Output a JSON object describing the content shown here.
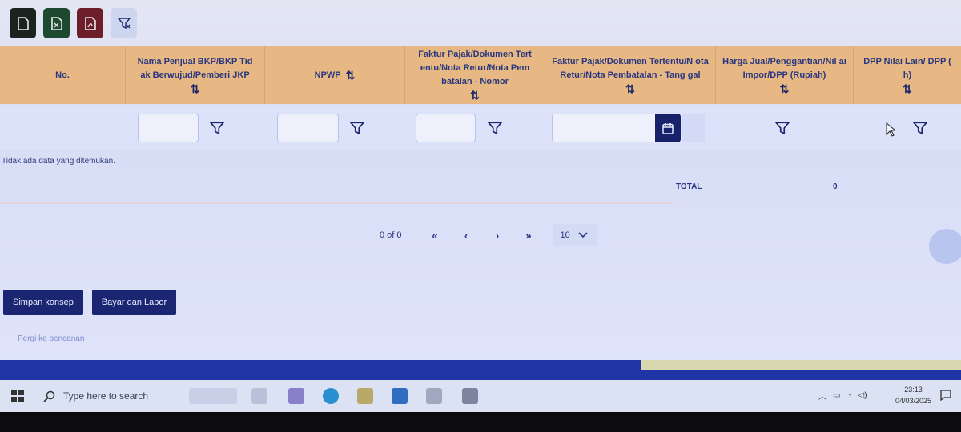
{
  "toolbar": {
    "buttons": [
      "new-doc-icon",
      "excel-icon",
      "pdf-icon",
      "clear-filter-icon"
    ]
  },
  "table": {
    "columns": [
      {
        "label": "No.",
        "sortable": false
      },
      {
        "label": "Nama Penjual BKP/BKP Tid ak Berwujud/Pemberi JKP",
        "sortable": true
      },
      {
        "label": "NPWP",
        "sortable": true
      },
      {
        "label": "Faktur Pajak/Dokumen Tert entu/Nota Retur/Nota Pem batalan - Nomor",
        "sortable": true
      },
      {
        "label": "Faktur Pajak/Dokumen Tertentu/N ota Retur/Nota Pembatalan - Tang gal",
        "sortable": true
      },
      {
        "label": "Harga Jual/Penggantian/Nil ai Impor/DPP (Rupiah)",
        "sortable": true
      },
      {
        "label": "DPP Nilai Lain/ DPP ( h)",
        "sortable": true
      }
    ],
    "sort_glyph": "⇅",
    "empty_message": "Tidak ada data yang ditemukan.",
    "total_label": "TOTAL",
    "total_value": "0"
  },
  "pager": {
    "count": "0 of 0",
    "first": "«",
    "prev": "‹",
    "next": "›",
    "last": "»",
    "page_size": "10"
  },
  "actions": {
    "save_draft": "Simpan konsep",
    "pay_report": "Bayar dan Lapor"
  },
  "top_link": "Pergi ke pencanan",
  "taskbar": {
    "search_placeholder": "Type here to search",
    "time": "23:13",
    "date": "04/03/2025"
  },
  "colors": {
    "header_bg": "#e7b883",
    "primary": "#1b2673",
    "accent_footer": "#1f34a5"
  }
}
